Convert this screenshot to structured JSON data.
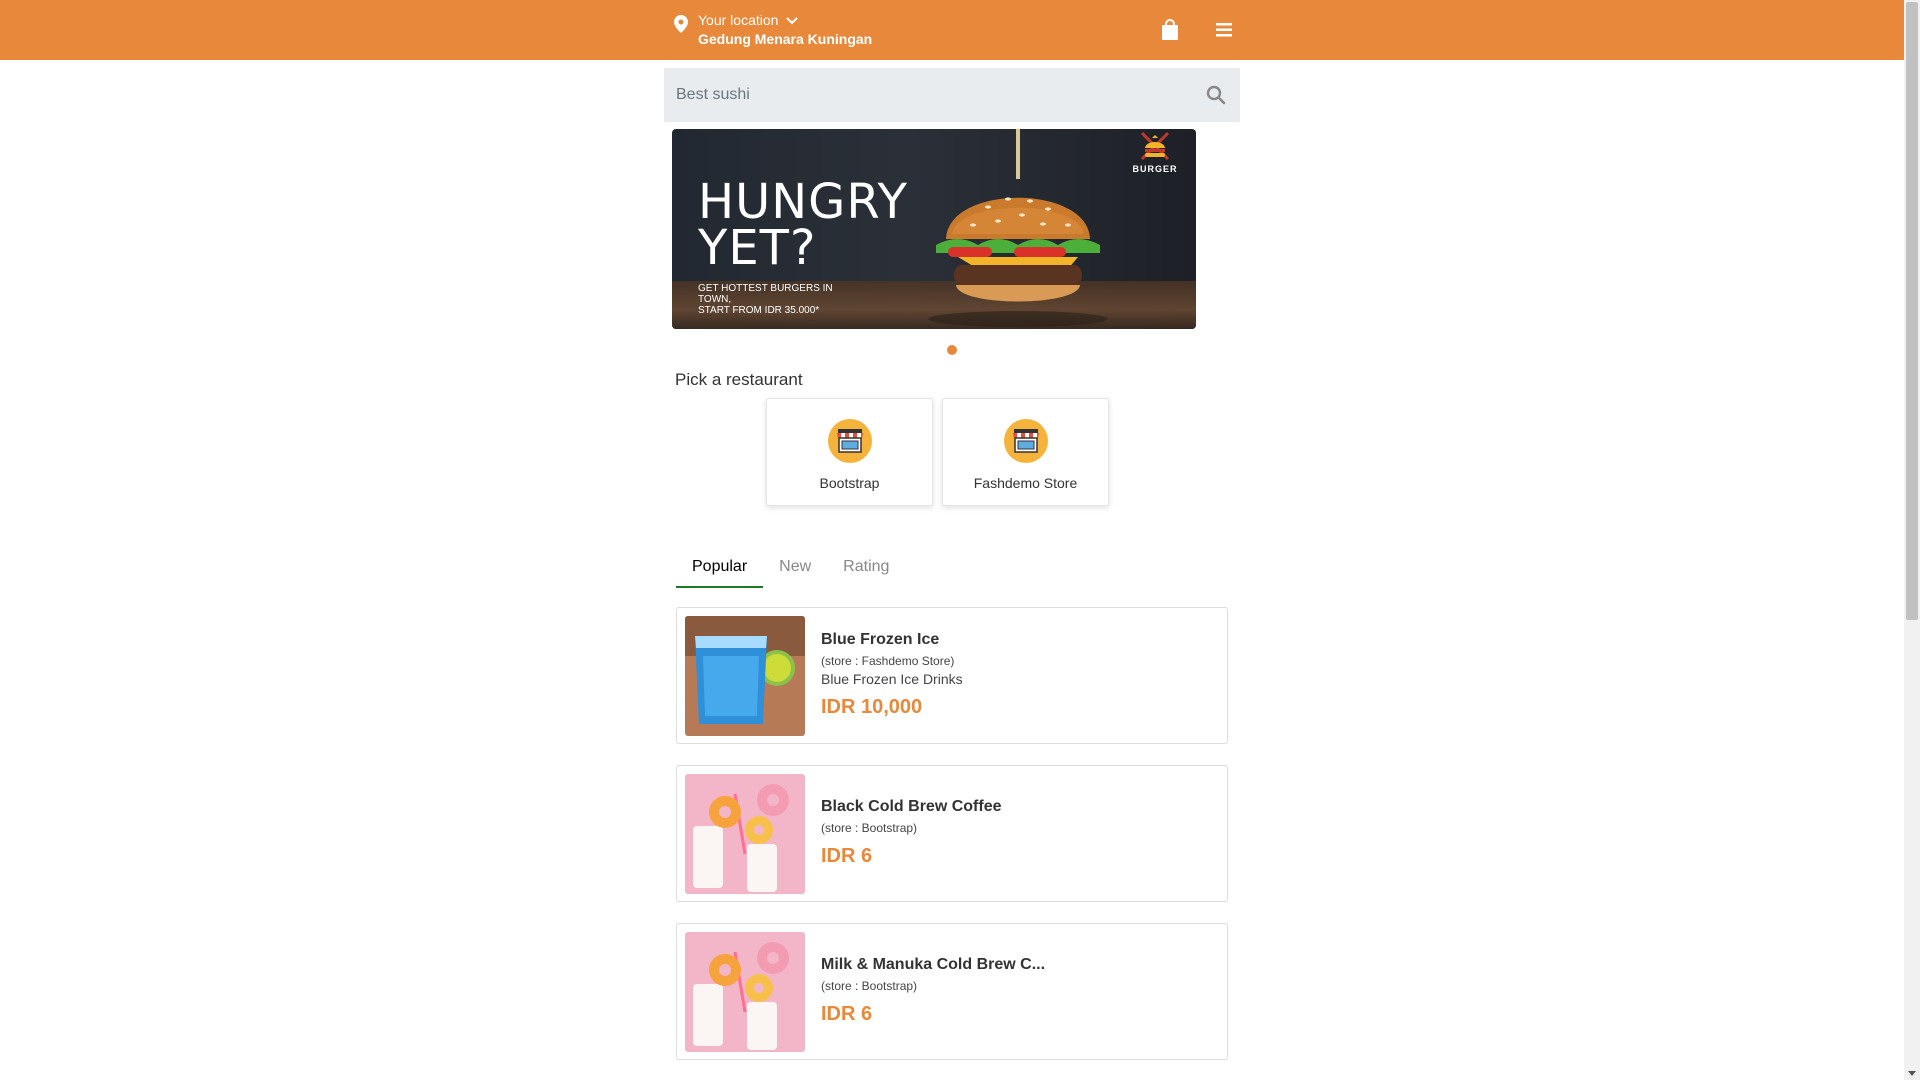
{
  "header": {
    "location_label": "Your location",
    "location_value": "Gedung Menara Kuningan",
    "icons": [
      "map-pin-icon",
      "chevron-down-icon",
      "shopping-bag-icon",
      "hamburger-menu-icon"
    ],
    "accent_color": "#e8883a"
  },
  "search": {
    "placeholder": "Best sushi",
    "icon": "search-icon"
  },
  "banner": {
    "headline_line1": "HUNGRY",
    "headline_line2": "YET?",
    "subtext_line1": "GET HOTTEST BURGERS IN TOWN,",
    "subtext_line2": "START FROM IDR 35.000*",
    "brand": "BURGER",
    "active_slide": 1,
    "slide_count": 1
  },
  "restaurants": {
    "title": "Pick a restaurant",
    "items": [
      {
        "name": "Bootstrap",
        "icon": "storefront-icon"
      },
      {
        "name": "Fashdemo Store",
        "icon": "storefront-icon"
      }
    ]
  },
  "tabs": [
    {
      "label": "Popular",
      "active": true
    },
    {
      "label": "New",
      "active": false
    },
    {
      "label": "Rating",
      "active": false
    }
  ],
  "products": [
    {
      "name": "Blue Frozen Ice",
      "store": "(store : Fashdemo Store)",
      "description": "Blue Frozen Ice Drinks",
      "price": "IDR 10,000"
    },
    {
      "name": "Black Cold Brew Coffee",
      "store": "(store : Bootstrap)",
      "description": "",
      "price": "IDR 6"
    },
    {
      "name": "Milk & Manuka Cold Brew C...",
      "store": "(store : Bootstrap)",
      "description": "",
      "price": "IDR 6"
    }
  ]
}
